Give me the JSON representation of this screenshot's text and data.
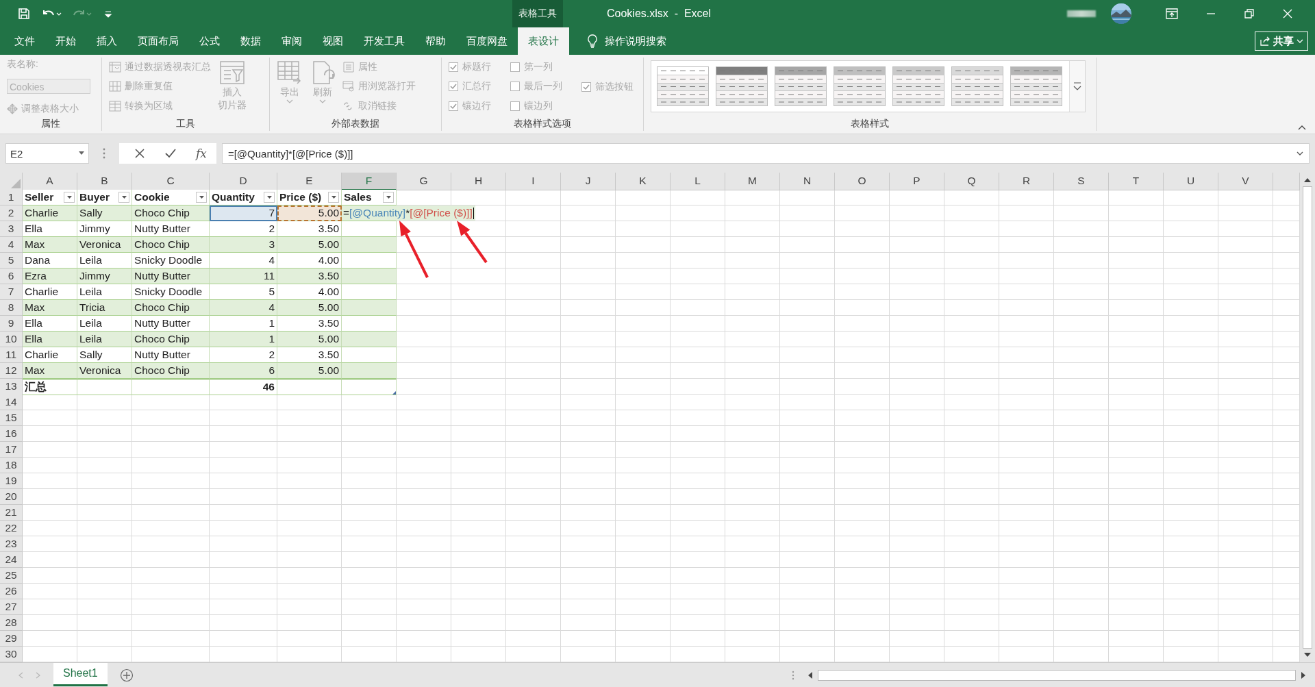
{
  "window": {
    "title": "Cookies.xlsx  -  Excel",
    "context_label": "表格工具"
  },
  "ribbon_tabs": [
    {
      "label": "文件",
      "selected": false
    },
    {
      "label": "开始",
      "selected": false
    },
    {
      "label": "插入",
      "selected": false
    },
    {
      "label": "页面布局",
      "selected": false
    },
    {
      "label": "公式",
      "selected": false
    },
    {
      "label": "数据",
      "selected": false
    },
    {
      "label": "审阅",
      "selected": false
    },
    {
      "label": "视图",
      "selected": false
    },
    {
      "label": "开发工具",
      "selected": false
    },
    {
      "label": "帮助",
      "selected": false
    },
    {
      "label": "百度网盘",
      "selected": false
    },
    {
      "label": "表设计",
      "selected": true
    }
  ],
  "tell_me": "操作说明搜索",
  "share": "共享",
  "ribbon": {
    "properties": {
      "name_label": "表名称:",
      "name_value": "Cookies",
      "resize": {
        "label": "调整表格大小",
        "disabled": true
      },
      "group": "属性"
    },
    "tools": {
      "commands": [
        {
          "label": "通过数据透视表汇总",
          "disabled": true
        },
        {
          "label": "删除重复值",
          "disabled": true
        },
        {
          "label": "转换为区域",
          "disabled": true
        }
      ],
      "slicer": {
        "lines": [
          "插入",
          "切片器"
        ],
        "disabled": true
      },
      "group": "工具"
    },
    "external": {
      "big": [
        {
          "label": "导出",
          "disabled": true
        },
        {
          "label": "刷新",
          "disabled": true
        }
      ],
      "commands": [
        {
          "label": "属性",
          "disabled": true
        },
        {
          "label": "用浏览器打开",
          "disabled": true
        },
        {
          "label": "取消链接",
          "disabled": true
        }
      ],
      "group": "外部表数据"
    },
    "style_options": {
      "columns": [
        [
          {
            "label": "标题行",
            "checked": true,
            "disabled": true
          },
          {
            "label": "汇总行",
            "checked": true,
            "disabled": true
          },
          {
            "label": "镶边行",
            "checked": true,
            "disabled": true
          }
        ],
        [
          {
            "label": "第一列",
            "checked": false,
            "disabled": true
          },
          {
            "label": "最后一列",
            "checked": false,
            "disabled": true
          },
          {
            "label": "镶边列",
            "checked": false,
            "disabled": true
          }
        ],
        [
          {
            "label": "筛选按钮",
            "checked": true,
            "disabled": true
          }
        ]
      ],
      "group": "表格样式选项"
    },
    "styles": {
      "items": [
        {
          "color": "#ffffff"
        },
        {
          "color": "#7f7f7f"
        },
        {
          "color": "#a6a6a6"
        },
        {
          "color": "#bfbfbf"
        },
        {
          "color": "#c9c9c9"
        },
        {
          "color": "#d9d9d9"
        },
        {
          "color": "#b5b5b5"
        }
      ],
      "group": "表格样式"
    }
  },
  "name_box": "E2",
  "function_label": "fx",
  "formula": "=[@Quantity]*[@[Price ($)]]",
  "columns": [
    {
      "label": "A",
      "selected": false
    },
    {
      "label": "B",
      "selected": false
    },
    {
      "label": "C",
      "selected": false
    },
    {
      "label": "D",
      "selected": false
    },
    {
      "label": "E",
      "selected": false
    },
    {
      "label": "F",
      "selected": true
    },
    {
      "label": "G",
      "selected": false
    },
    {
      "label": "H",
      "selected": false
    },
    {
      "label": "I",
      "selected": false
    },
    {
      "label": "J",
      "selected": false
    },
    {
      "label": "K",
      "selected": false
    },
    {
      "label": "L",
      "selected": false
    },
    {
      "label": "M",
      "selected": false
    },
    {
      "label": "N",
      "selected": false
    },
    {
      "label": "O",
      "selected": false
    },
    {
      "label": "P",
      "selected": false
    },
    {
      "label": "Q",
      "selected": false
    },
    {
      "label": "R",
      "selected": false
    },
    {
      "label": "S",
      "selected": false
    },
    {
      "label": "T",
      "selected": false
    },
    {
      "label": "U",
      "selected": false
    },
    {
      "label": "V",
      "selected": false
    }
  ],
  "row_numbers": [
    "1",
    "2",
    "3",
    "4",
    "5",
    "6",
    "7",
    "8",
    "9",
    "10",
    "11",
    "12",
    "13",
    "14",
    "15",
    "16",
    "17",
    "18",
    "19",
    "20",
    "21",
    "22",
    "23",
    "24",
    "25",
    "26",
    "27",
    "28",
    "29",
    "30"
  ],
  "table": {
    "headers": [
      {
        "label": "Seller",
        "kind": "plain"
      },
      {
        "label": "Buyer",
        "kind": "plain"
      },
      {
        "label": "Cookie",
        "kind": "plain"
      },
      {
        "label": "Quantity",
        "kind": "solid-reference",
        "color": "#4a7fb0"
      },
      {
        "label": "Price ($)",
        "kind": "dashed-reference",
        "color": "#b8732f"
      },
      {
        "label": "Sales",
        "kind": "plain"
      }
    ],
    "rows": [
      {
        "cells": [
          "Charlie",
          "Sally",
          "Choco Chip",
          "7",
          "5.00"
        ],
        "editor": [
          {
            "text": "="
          },
          {
            "text": "[@Quantity]",
            "color": "#4a86b8"
          },
          {
            "text": "*"
          },
          {
            "text": "[@[Price ($)]]",
            "color": "#d0504a"
          }
        ]
      },
      {
        "cells": [
          "Ella",
          "Jimmy",
          "Nutty Butter",
          "2",
          "3.50"
        ]
      },
      {
        "cells": [
          "Max",
          "Veronica",
          "Choco Chip",
          "3",
          "5.00"
        ]
      },
      {
        "cells": [
          "Dana",
          "Leila",
          "Snicky Doodle",
          "4",
          "4.00"
        ]
      },
      {
        "cells": [
          "Ezra",
          "Jimmy",
          "Nutty Butter",
          "11",
          "3.50"
        ]
      },
      {
        "cells": [
          "Charlie",
          "Leila",
          "Snicky Doodle",
          "5",
          "4.00"
        ]
      },
      {
        "cells": [
          "Max",
          "Tricia",
          "Choco Chip",
          "4",
          "5.00"
        ]
      },
      {
        "cells": [
          "Ella",
          "Leila",
          "Nutty Butter",
          "1",
          "3.50"
        ]
      },
      {
        "cells": [
          "Ella",
          "Leila",
          "Choco Chip",
          "1",
          "5.00"
        ]
      },
      {
        "cells": [
          "Charlie",
          "Sally",
          "Nutty Butter",
          "2",
          "3.50"
        ]
      },
      {
        "cells": [
          "Max",
          "Veronica",
          "Choco Chip",
          "6",
          "5.00"
        ]
      }
    ],
    "total": {
      "label": "汇总",
      "quantity": "46"
    }
  },
  "sheet_tabs": [
    {
      "label": "Sheet1",
      "selected": true
    }
  ]
}
